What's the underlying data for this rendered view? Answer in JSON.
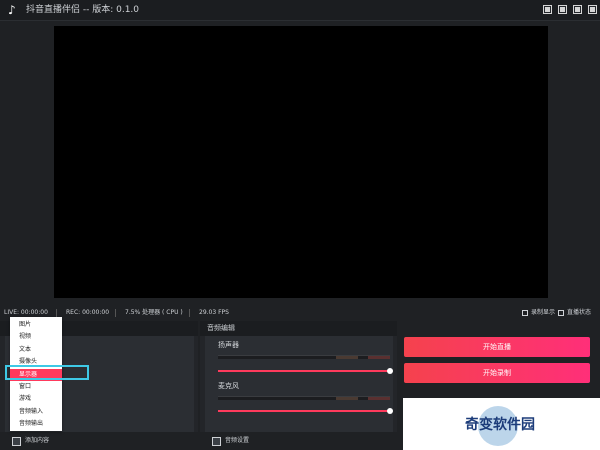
{
  "titlebar": {
    "title": "抖音直播伴侣 -- 版本: 0.1.0",
    "logo_icon": "tiktok-note-icon",
    "window_buttons": [
      "settings-icon",
      "minimize-icon",
      "maximize-icon",
      "close-icon"
    ]
  },
  "statusbar": {
    "live": "LIVE: 00:00:00",
    "rec": "REC: 00:00:00",
    "cpu": "7.5% 处理器 ( CPU )",
    "fps": "29.03 FPS",
    "show_recording": "录制显示",
    "live_status": "直播状态"
  },
  "source_panel": {
    "add_content": "添加内容"
  },
  "context_menu": {
    "items": [
      "图片",
      "视频",
      "文本",
      "摄像头",
      "显示器",
      "窗口",
      "游戏",
      "音频输入",
      "音频输出"
    ],
    "selected": "显示器"
  },
  "audio_panel": {
    "title": "音频编辑",
    "speaker_label": "扬声器",
    "mic_label": "麦克风",
    "speaker_volume": 1.0,
    "mic_volume": 1.0,
    "settings_label": "音频设置"
  },
  "actions": {
    "start_live": "开始直播",
    "start_record": "开始录制"
  },
  "watermark": {
    "text": "奇变软件园"
  },
  "colors": {
    "accent": "#ff3a5c",
    "highlight_border": "#3ec9e6",
    "background": "#1f2124"
  }
}
